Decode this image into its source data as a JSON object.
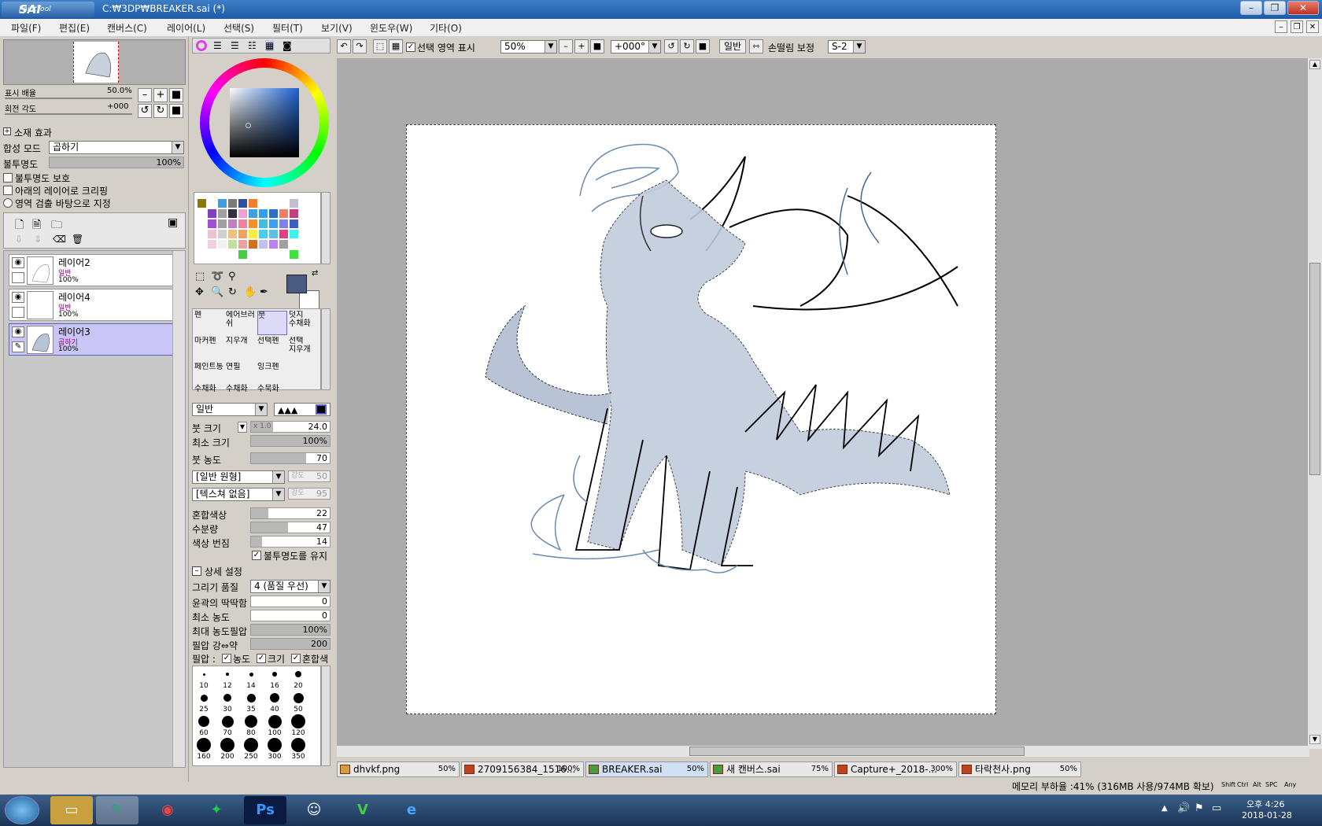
{
  "window": {
    "app": "Paint Tool SAI",
    "path": "C:₩3DP₩BREAKER.sai (*)"
  },
  "menu": [
    "파일(F)",
    "편집(E)",
    "캔버스(C)",
    "레이어(L)",
    "선택(S)",
    "필터(T)",
    "보기(V)",
    "윈도우(W)",
    "기타(O)"
  ],
  "navigator": {
    "zoom_label": "표시 배율",
    "zoom_value": "50.0%",
    "angle_label": "회전 각도",
    "angle_value": "+000"
  },
  "layer_panel": {
    "effect_label": "소재 효과",
    "blend_label": "합성 모드",
    "blend_value": "곱하기",
    "opacity_label": "불투명도",
    "opacity_value": "100%",
    "opacity_fraction": 1.0,
    "check_protect": "불투명도 보호",
    "check_clip": "아래의 레이어로 크리핑",
    "check_select": "영역 검출 바탕으로 지정",
    "layers": [
      {
        "name": "레이어2",
        "mode": "일반",
        "opacity": "100%"
      },
      {
        "name": "레이어4",
        "mode": "일반",
        "opacity": "100%"
      },
      {
        "name": "레이어3",
        "mode": "곱하기",
        "opacity": "100%"
      }
    ]
  },
  "tools": [
    {
      "name": "펜",
      "s": ""
    },
    {
      "name": "에어브러쉬",
      "s": ""
    },
    {
      "name": "붓",
      "s": ""
    },
    {
      "name": "덧지",
      "s": "수채화"
    },
    {
      "name": "마커펜",
      "s": ""
    },
    {
      "name": "지우개",
      "s": ""
    },
    {
      "name": "선택펜",
      "s": ""
    },
    {
      "name": "선택",
      "s": "지우개"
    },
    {
      "name": "페인트통",
      "s": ""
    },
    {
      "name": "연필",
      "s": ""
    },
    {
      "name": "잉크펜",
      "s": ""
    },
    {
      "name": "",
      "s": ""
    }
  ],
  "tool_subs": [
    "수채화",
    "수채화",
    "수묵화"
  ],
  "brush": {
    "mode": "일반",
    "size_label": "붓 크기",
    "size_mult": "x 1.0",
    "size_value": "24.0",
    "min_size_label": "최소 크기",
    "min_size_value": "100%",
    "density_label": "붓 농도",
    "density_value": "70",
    "shape": "[일반 원형]",
    "shape_strength_label": "강도",
    "shape_strength": "50",
    "texture": "[텍스쳐 없음]",
    "texture_strength_label": "강도",
    "texture_strength": "95",
    "blend_label": "혼합색상",
    "blend_value": "22",
    "water_label": "수분량",
    "water_value": "47",
    "bleed_label": "색상 번짐",
    "bleed_value": "14",
    "keep_opacity": "불투명도를 유지",
    "detail_label": "상세 설정",
    "quality_label": "그리기 품질",
    "quality_value": "4 (품질 우선)",
    "edge_label": "윤곽의 딱딱함",
    "edge_value": "0",
    "min_density_label": "최소 농도",
    "min_density_value": "0",
    "max_pressure_label": "최대 농도필압",
    "max_pressure_value": "100%",
    "pressure_label": "필압 강⇔약",
    "pressure_value": "200",
    "pressure_chk_label": "필압 :",
    "chk_density": "농도",
    "chk_size": "크기",
    "chk_blend": "혼합색"
  },
  "brush_sizes": [
    "10",
    "12",
    "14",
    "16",
    "20",
    "25",
    "30",
    "35",
    "40",
    "50",
    "60",
    "70",
    "80",
    "100",
    "120",
    "160",
    "200",
    "250",
    "300",
    "350"
  ],
  "toolbar": {
    "show_selection": "선택 영역 표시",
    "zoom": "50%",
    "angle": "+000°",
    "mode": "일반",
    "stabilizer_label": "손떨림 보정",
    "stabilizer": "S-2"
  },
  "doc_tabs": [
    {
      "name": "dhvkf.png",
      "zoom": "50%"
    },
    {
      "name": "2709156384_1516...",
      "zoom": "100%"
    },
    {
      "name": "BREAKER.sai",
      "zoom": "50%"
    },
    {
      "name": "새 캔버스.sai",
      "zoom": "75%"
    },
    {
      "name": "Capture+_2018-...",
      "zoom": "300%"
    },
    {
      "name": "타락천사.png",
      "zoom": "50%"
    }
  ],
  "status": {
    "memory": "메모리 부하율 :41% (316MB 사용/974MB 확보)",
    "keys": [
      "Shift",
      "Ctrl",
      "Alt",
      "SPC",
      "Any"
    ]
  },
  "taskbar": {
    "time": "오후 4:26",
    "date": "2018-01-28"
  },
  "colors": {
    "accent": "#1f5aa8",
    "selected_layer": "#c9c6f5",
    "current_color": "#4a5a80"
  }
}
